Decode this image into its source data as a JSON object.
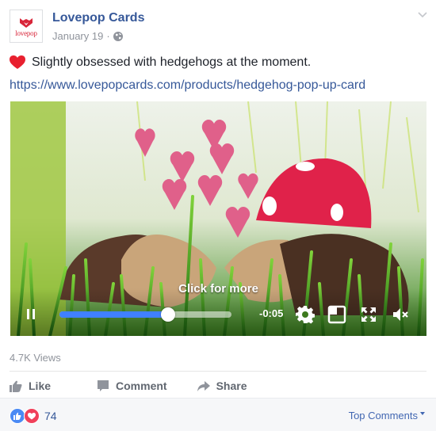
{
  "post": {
    "page_name": "Lovepop Cards",
    "avatar_text": "lovepop",
    "date": "January 19",
    "separator": "·",
    "privacy_icon": "globe-icon",
    "options_icon": "chevron-down-icon",
    "message": "Slightly obsessed with hedgehogs at the moment.",
    "message_emoji": "red-heart",
    "link": "https://www.lovepopcards.com/products/hedgehog-pop-up-card"
  },
  "video": {
    "cta": "Click for more",
    "time_remaining": "-0:05",
    "progress": 0.63,
    "controls": [
      "pause-icon",
      "settings-icon",
      "picture-in-picture-icon",
      "fullscreen-icon",
      "mute-icon"
    ]
  },
  "stats": {
    "views": "4.7K Views"
  },
  "actions": {
    "like": "Like",
    "comment": "Comment",
    "share": "Share"
  },
  "footer": {
    "reactions": [
      "like",
      "love"
    ],
    "reaction_count": "74",
    "sort_label": "Top Comments"
  },
  "colors": {
    "brand_blue": "#365899",
    "progress_blue": "#4080ff",
    "love_red": "#f0405a",
    "like_blue": "#4a8af4"
  }
}
